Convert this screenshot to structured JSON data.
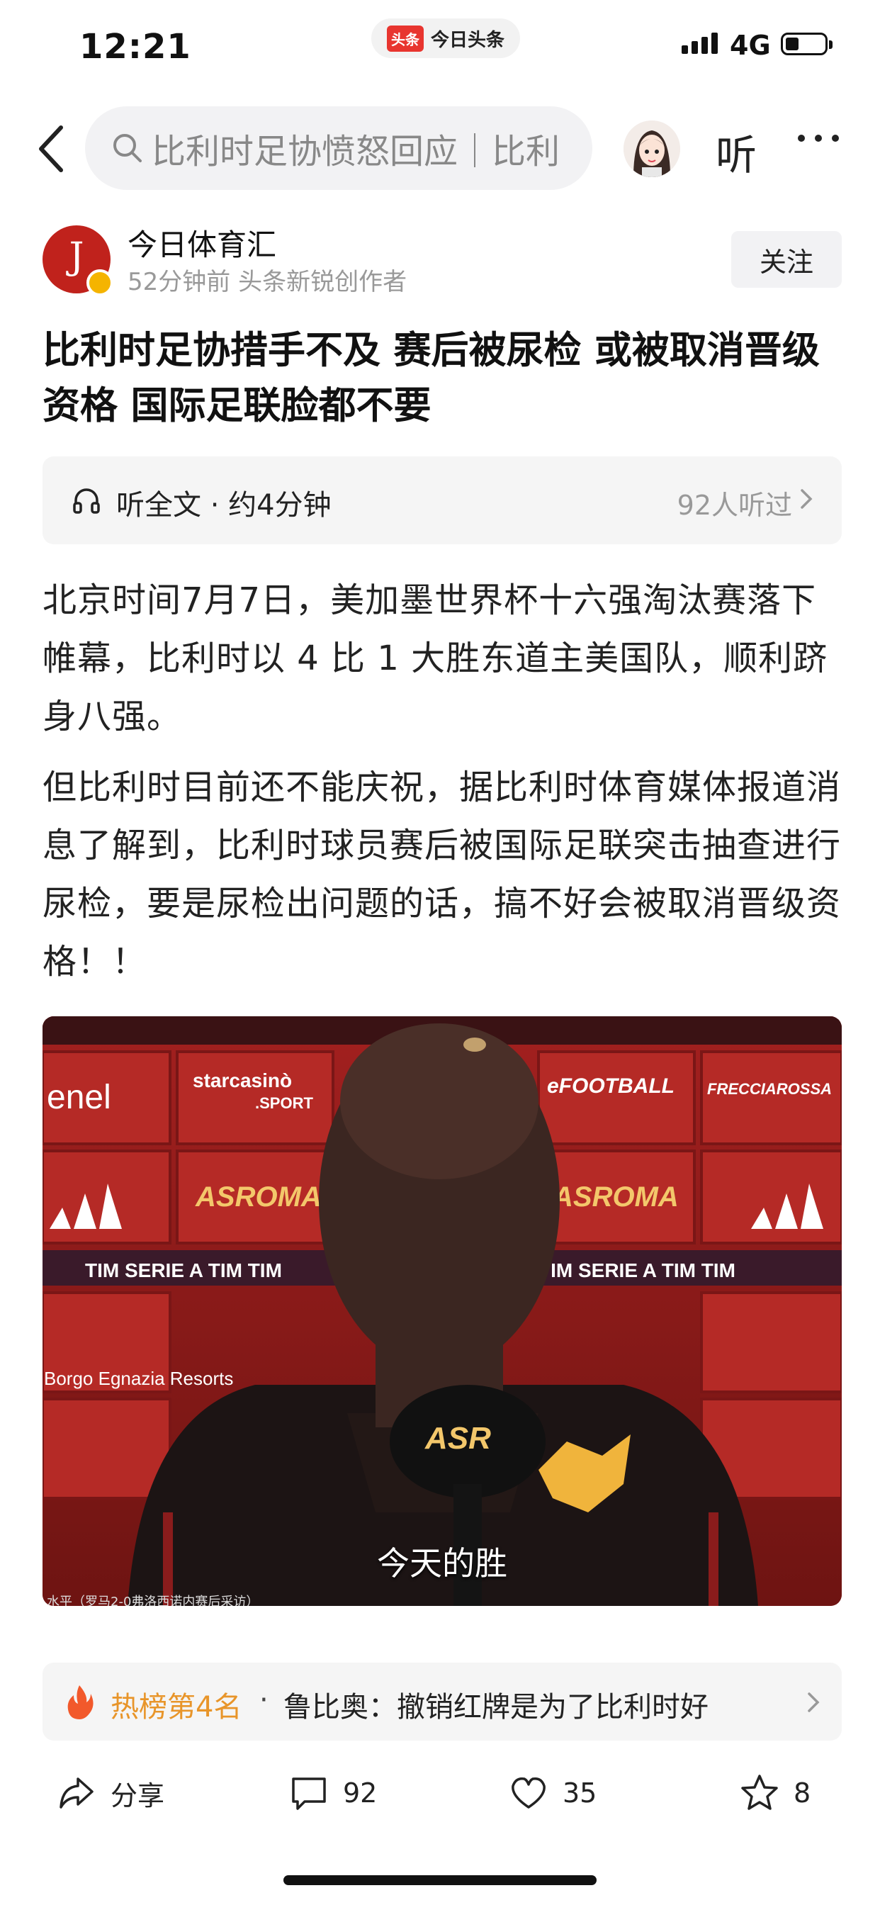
{
  "status_bar": {
    "time": "12:21",
    "app_logo": "头条",
    "app_name": "今日头条",
    "network": "4G"
  },
  "nav": {
    "search_text": "比利时足协愤怒回应｜比利",
    "listen_label": "听"
  },
  "author": {
    "monogram": "J",
    "name": "今日体育汇",
    "meta": "52分钟前  头条新锐创作者",
    "follow_label": "关注"
  },
  "article": {
    "title": "比利时足协措手不及 赛后被尿检 或被取消晋级资格 国际足联脸都不要",
    "listen_bar": {
      "label": "听全文 · 约4分钟",
      "count": "92人听过"
    },
    "paragraphs": [
      "北京时间7月7日，美加墨世界杯十六强淘汰赛落下帷幕，比利时以 4 比 1 大胜东道主美国队，顺利跻身八强。",
      "但比利时目前还不能庆祝，据比利时体育媒体报道消息了解到，比利时球员赛后被国际足联突击抽查进行尿检，要是尿检出问题的话，搞不好会被取消晋级资格！！"
    ],
    "image": {
      "caption": "今天的胜",
      "credit": "水平（罗马2-0弗洛西诺内赛后采访）",
      "sponsors": [
        "enel",
        "starcasinò .SPORT",
        "eFOOTBALL",
        "FRECCIAROSSA",
        "ASROMA",
        "TIM",
        "SERIE A",
        "Borgo Egnazia Resorts",
        "ASR"
      ]
    }
  },
  "hot": {
    "rank": "热榜第4名",
    "separator": "·",
    "text": "鲁比奥：撤销红牌是为了比利时好"
  },
  "actions": {
    "share_label": "分享",
    "comment_count": "92",
    "like_count": "35",
    "favorite_count": "8"
  }
}
